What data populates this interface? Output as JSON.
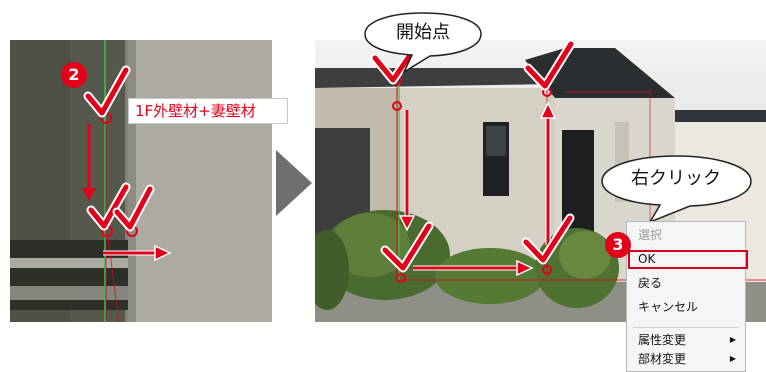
{
  "left_panel": {
    "wall_label": "1F外壁材+妻壁材",
    "step_number": "2"
  },
  "right_panel": {
    "start_point_bubble": "開始点",
    "right_click_bubble": "右クリック",
    "step_number": "3"
  },
  "context_menu": {
    "items": [
      {
        "label": "選択",
        "enabled": false
      },
      {
        "label": "OK",
        "enabled": true,
        "highlighted": true
      },
      {
        "label": "戻る",
        "enabled": true
      },
      {
        "label": "キャンセル",
        "enabled": true
      },
      {
        "label": "属性変更",
        "enabled": true,
        "submenu": true
      },
      {
        "label": "部材変更",
        "enabled": true,
        "submenu": true
      }
    ]
  },
  "colors": {
    "accent_red": "#e2001a",
    "next_arrow_gray": "#6f6f6f"
  },
  "icons": [
    "checkmark-icon",
    "next-arrow-icon",
    "submenu-arrow-icon"
  ]
}
